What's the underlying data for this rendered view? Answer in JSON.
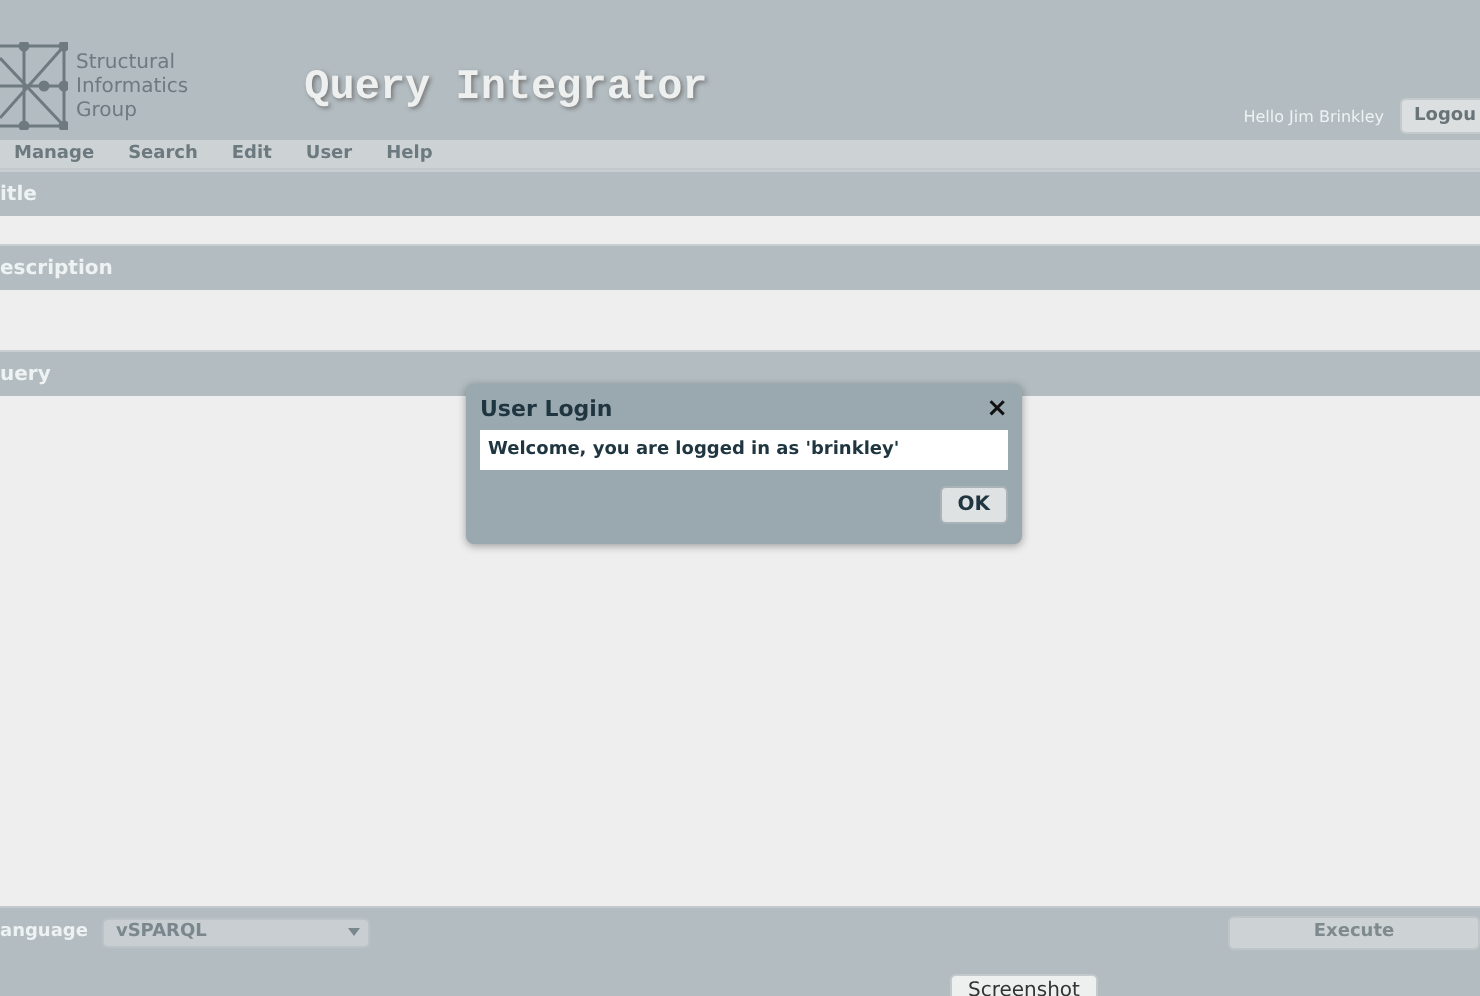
{
  "header": {
    "logo_lines": [
      "Structural",
      "Informatics",
      "Group"
    ],
    "title": "Query Integrator",
    "greeting": "Hello Jim Brinkley",
    "logout_button": "Logou"
  },
  "menu": [
    "Manage",
    "Search",
    "Edit",
    "User",
    "Help"
  ],
  "sections": [
    {
      "kind": "line",
      "label": "itle"
    },
    {
      "kind": "area",
      "label": "escription"
    },
    {
      "kind": "query",
      "label": "uery"
    }
  ],
  "footer": {
    "language_label": "anguage",
    "language_value": "vSPARQL",
    "execute_button": "Execute",
    "screenshot_button": "Screenshot"
  },
  "dialog": {
    "title": "User Login",
    "close": "×",
    "message": "Welcome, you are logged in as 'brinkley'",
    "ok_button": "OK"
  }
}
